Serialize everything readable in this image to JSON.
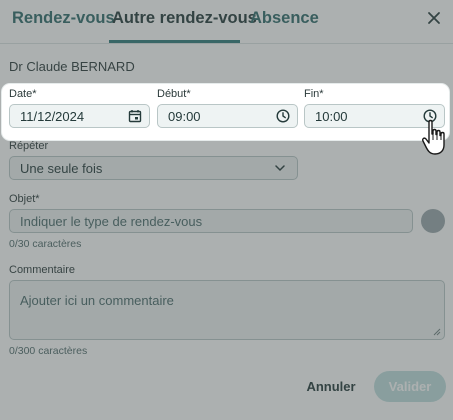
{
  "tabs": [
    {
      "label": "Rendez-vous"
    },
    {
      "label": "Autre rendez-vous"
    },
    {
      "label": "Absence"
    }
  ],
  "close_icon": "close-icon",
  "doctor_name": "Dr Claude BERNARD",
  "date": {
    "label": "Date*",
    "value": "11/12/2024",
    "icon": "calendar-icon"
  },
  "debut": {
    "label": "Début*",
    "value": "09:00",
    "icon": "clock-icon"
  },
  "fin": {
    "label": "Fin*",
    "value": "10:00",
    "icon": "clock-icon"
  },
  "repeat": {
    "label": "Répéter",
    "value": "Une seule fois"
  },
  "objet": {
    "label": "Objet*",
    "placeholder": "Indiquer le type de rendez-vous",
    "counter": "0/30 caractères"
  },
  "comment": {
    "label": "Commentaire",
    "placeholder": "Ajouter ici un commentaire",
    "counter": "0/300 caractères"
  },
  "buttons": {
    "cancel": "Annuler",
    "save": "Valider"
  },
  "colors": {
    "accent": "#2e7b7b",
    "overlay": "#465050",
    "save_disabled": "#bfdfdf"
  }
}
